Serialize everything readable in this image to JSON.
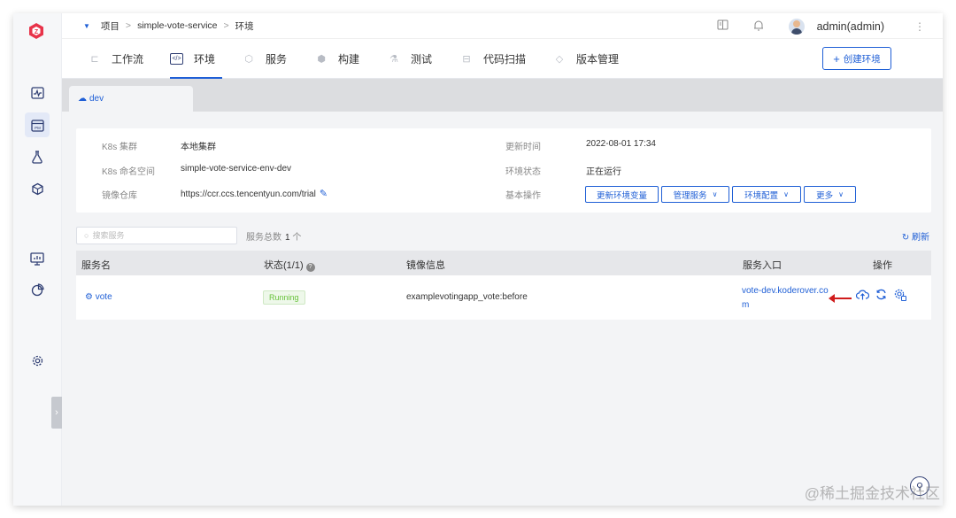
{
  "breadcrumb": [
    "项目",
    "simple-vote-service",
    "环境"
  ],
  "user": {
    "name": "admin(admin)"
  },
  "nav": {
    "tabs": [
      {
        "label": "工作流",
        "icon": "workflow-icon"
      },
      {
        "label": "环境",
        "icon": "environment-code-icon",
        "active": true
      },
      {
        "label": "服务",
        "icon": "service-icon"
      },
      {
        "label": "构建",
        "icon": "build-icon"
      },
      {
        "label": "测试",
        "icon": "test-flask-icon"
      },
      {
        "label": "代码扫描",
        "icon": "scan-icon"
      },
      {
        "label": "版本管理",
        "icon": "version-tag-icon"
      }
    ],
    "create_label": "创建环境"
  },
  "env_tab": {
    "label": "dev"
  },
  "info": {
    "cluster_label": "K8s 集群",
    "cluster_value": "本地集群",
    "namespace_label": "K8s 命名空间",
    "namespace_value": "simple-vote-service-env-dev",
    "registry_label": "镜像仓库",
    "registry_value": "https://ccr.ccs.tencentyun.com/trial",
    "updated_label": "更新时间",
    "updated_value": "2022-08-01 17:34",
    "status_label": "环境状态",
    "status_value": "正在运行",
    "ops_label": "基本操作",
    "ops": {
      "update_vars": "更新环境变量",
      "manage_services": "管理服务",
      "env_config": "环境配置",
      "more": "更多"
    }
  },
  "search": {
    "placeholder": "搜索服务"
  },
  "summary": {
    "label": "服务总数",
    "count": "1",
    "unit": "个"
  },
  "refresh_label": "刷新",
  "table": {
    "headers": {
      "name": "服务名",
      "status": "状态(1/1)",
      "image": "镜像信息",
      "entry": "服务入口",
      "ops": "操作"
    },
    "rows": [
      {
        "name": "vote",
        "status": "Running",
        "image": "examplevotingapp_vote:before",
        "entry": "vote-dev.koderover.com"
      }
    ]
  },
  "watermark": "@稀土掘金技术社区",
  "colors": {
    "accent": "#1f5fd6",
    "running": "#67c23a",
    "arrow": "#d01c1c"
  }
}
